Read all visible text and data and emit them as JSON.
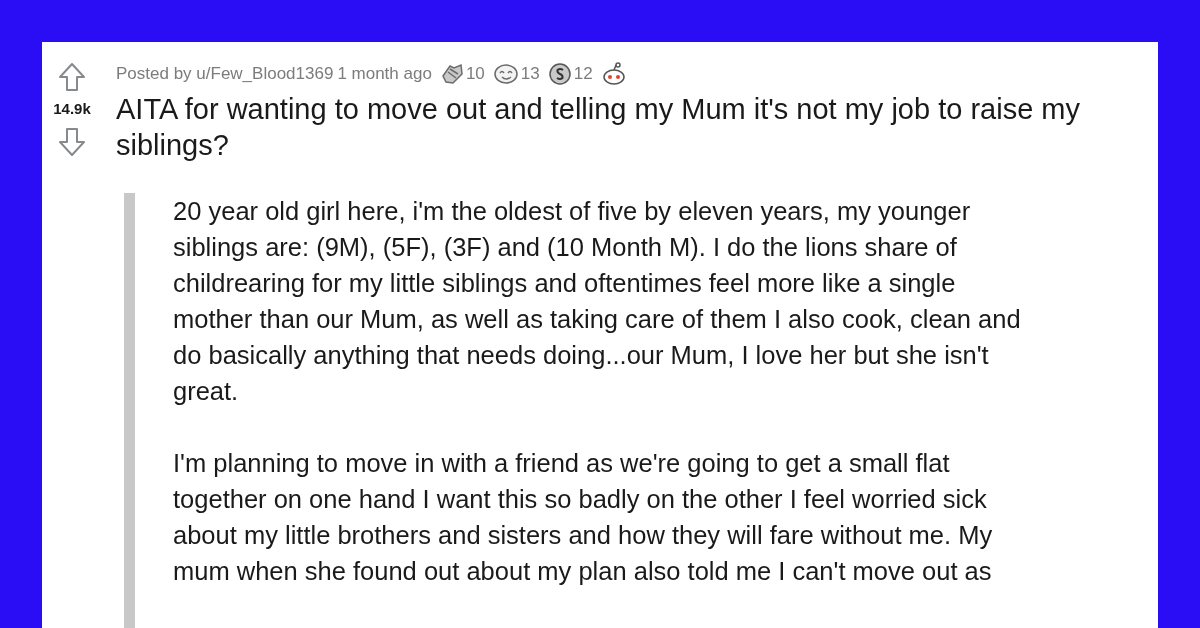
{
  "post": {
    "score": "14.9k",
    "meta": {
      "posted_by": "Posted by u/Few_Blood1369",
      "time": "1 month ago"
    },
    "awards": [
      {
        "kind": "hands",
        "count": "10"
      },
      {
        "kind": "face",
        "count": "13"
      },
      {
        "kind": "coin",
        "count": "12"
      },
      {
        "kind": "robot"
      }
    ],
    "title": "AITA for wanting to move out and telling my Mum it's not my job to raise my siblings?",
    "paragraphs": [
      {
        "lines": [
          "20 year old girl here, i'm the oldest of five by eleven years, my younger",
          "siblings are: (9M), (5F), (3F) and (10 Month M). I do the lions share of",
          "childrearing for my little siblings and oftentimes feel more like a single",
          "mother than our Mum, as well as taking care of them I also cook, clean and",
          "do basically anything that needs doing...our Mum, I love her but she isn't",
          "great."
        ]
      },
      {
        "lines": [
          "I'm planning to move in with a friend as we're going to get a small flat",
          "together on one hand I want this so badly on the other I feel worried sick",
          "about my little brothers and sisters and how they will fare without me. My",
          "mum when she found out about my plan also told me I can't move out as"
        ]
      }
    ]
  }
}
